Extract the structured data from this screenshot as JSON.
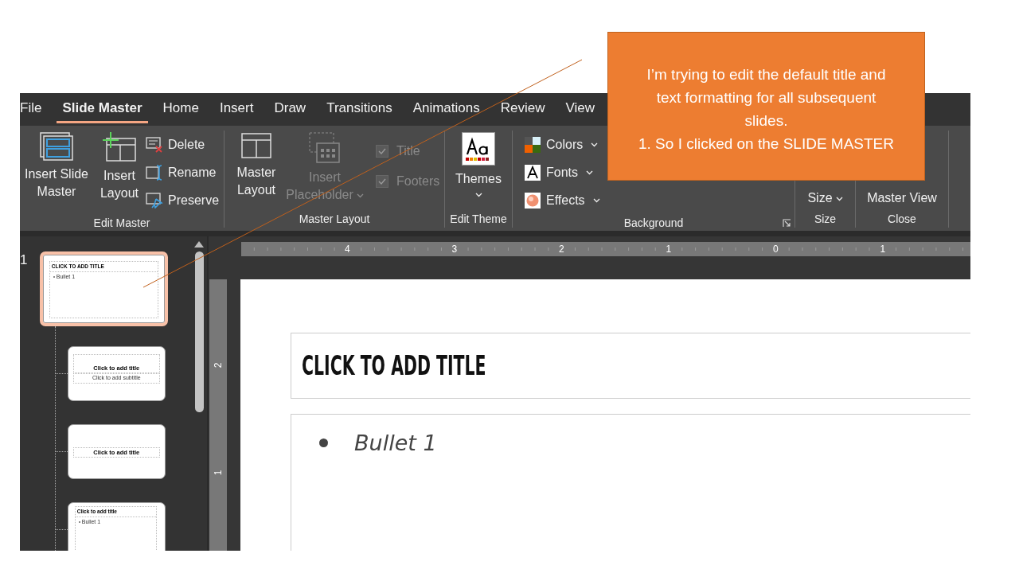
{
  "callout": {
    "lines": [
      "I’m trying to edit the default title and text formatting for all subsequent slides.",
      "1. So I clicked on the SLIDE MASTER"
    ]
  },
  "tabs": [
    {
      "label": "File",
      "selected": false
    },
    {
      "label": "Slide Master",
      "selected": true
    },
    {
      "label": "Home",
      "selected": false
    },
    {
      "label": "Insert",
      "selected": false
    },
    {
      "label": "Draw",
      "selected": false
    },
    {
      "label": "Transitions",
      "selected": false
    },
    {
      "label": "Animations",
      "selected": false
    },
    {
      "label": "Review",
      "selected": false
    },
    {
      "label": "View",
      "selected": false
    }
  ],
  "ribbon": {
    "groups": [
      {
        "label": "Edit Master",
        "buttons": [
          {
            "label": "Insert Slide Master"
          },
          {
            "label": "Insert Layout"
          }
        ],
        "commands": [
          {
            "label": "Delete"
          },
          {
            "label": "Rename"
          },
          {
            "label": "Preserve"
          }
        ]
      },
      {
        "label": "Master Layout",
        "buttons": [
          {
            "label": "Master Layout",
            "disabled": false
          },
          {
            "label": "Insert Placeholder",
            "disabled": true
          }
        ],
        "checkboxes": [
          {
            "label": "Title",
            "checked": true,
            "disabled": true
          },
          {
            "label": "Footers",
            "checked": true,
            "disabled": true
          }
        ]
      },
      {
        "label": "Edit Theme",
        "buttons": [
          {
            "label": "Themes"
          }
        ]
      },
      {
        "label": "Background",
        "commands": [
          {
            "label": "Colors"
          },
          {
            "label": "Fonts"
          },
          {
            "label": "Effects"
          }
        ]
      },
      {
        "label": "Size",
        "buttons": [
          {
            "label": "Size"
          }
        ]
      },
      {
        "label": "Close",
        "buttons": [
          {
            "label": "Master View"
          }
        ]
      }
    ]
  },
  "slide_number": "1",
  "thumbnails": [
    {
      "kind": "title-content",
      "selected": true,
      "title": "CLICK TO ADD TITLE",
      "body": "Bullet 1"
    },
    {
      "kind": "title-slide",
      "selected": false,
      "title": "Click to add title",
      "subtitle": "Click to add subtitle"
    },
    {
      "kind": "title-only",
      "selected": false,
      "title": "Click to add title"
    },
    {
      "kind": "title-content",
      "selected": false,
      "title": "Click to add title",
      "body": "Bullet 1"
    }
  ],
  "rulers": {
    "horizontal": [
      "4",
      "3",
      "2",
      "1",
      "0",
      "1"
    ],
    "vertical": [
      "2",
      "1"
    ]
  },
  "slide": {
    "title": "CLICK TO ADD TITLE",
    "bullets": [
      "Bullet 1"
    ]
  }
}
